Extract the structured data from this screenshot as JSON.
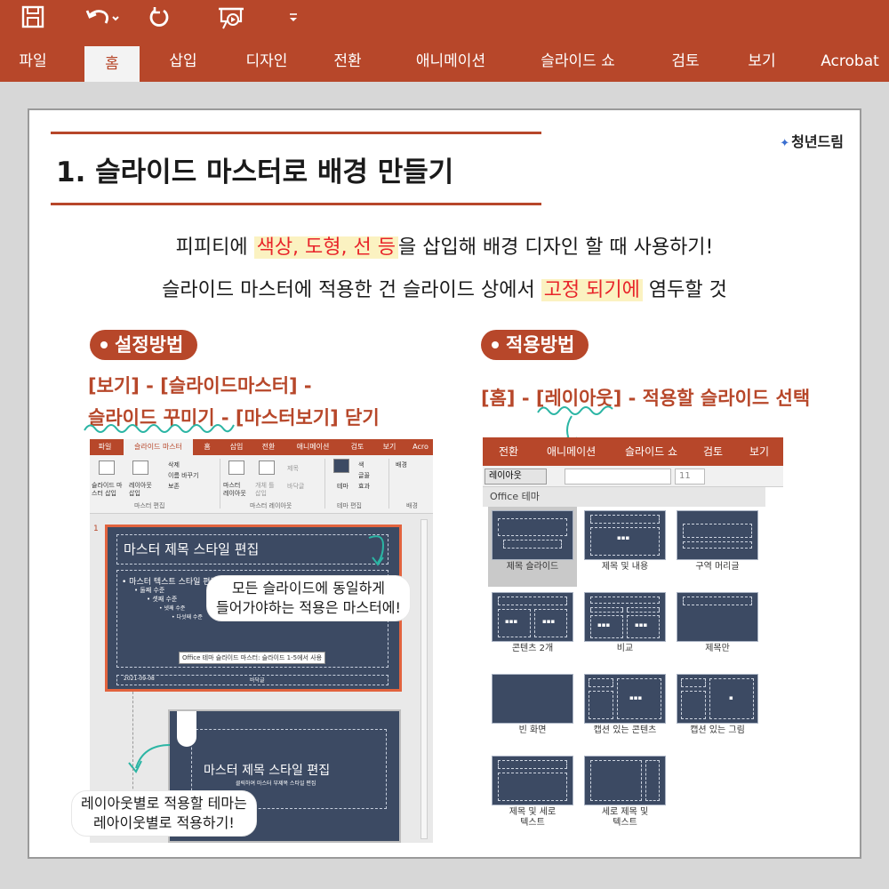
{
  "qat": {
    "save_icon": "save-icon",
    "undo_icon": "undo-icon",
    "redo_icon": "redo-icon",
    "present_icon": "present-from-start-icon",
    "customize_icon": "customize-qat-icon"
  },
  "ribbon_tabs": [
    {
      "label": "파일"
    },
    {
      "label": "홈",
      "active": true
    },
    {
      "label": "삽입"
    },
    {
      "label": "디자인"
    },
    {
      "label": "전환"
    },
    {
      "label": "애니메이션"
    },
    {
      "label": "슬라이드 쇼"
    },
    {
      "label": "검토"
    },
    {
      "label": "보기"
    },
    {
      "label": "Acrobat"
    }
  ],
  "card": {
    "title": "1. 슬라이드 마스터로 배경 만들기",
    "logo": "청년드림",
    "line1_pre": "피피티에 ",
    "line1_hl": "색상, 도형, 선 등",
    "line1_post": "을 삽입해  배경 디자인 할 때 사용하기!",
    "line2_pre": "슬라이드 마스터에 적용한 건 슬라이드 상에서 ",
    "line2_hl": "고정 되기에",
    "line2_post": " 염두할 것"
  },
  "setup": {
    "pill": "설정방법",
    "path_line1": "[보기] - [슬라이드마스터] -",
    "path_line2": "슬라이드 꾸미기 - [마스터보기] 닫기"
  },
  "apply": {
    "pill": "적용방법",
    "path": "[홈] - [레이아웃] - 적용할 슬라이드 선택"
  },
  "left_shot": {
    "tabs": [
      "파일",
      "슬라이드 마스터",
      "홈",
      "삽입",
      "전환",
      "애니메이션",
      "검토",
      "보기",
      "Acro"
    ],
    "ribbon": {
      "insert_master": "슬라이드 마\n스터 삽입",
      "insert_layout": "레이아웃\n삽입",
      "delete": "삭제",
      "rename": "이름 바꾸기",
      "preserve": "보존",
      "group1": "마스터 편집",
      "master_layout": "마스터\n레이아웃",
      "insert_placeholder": "개체 틀\n삽입",
      "title_check": "제목",
      "footer_check": "바닥글",
      "group2": "마스터 레이아웃",
      "theme": "테마",
      "colors": "색",
      "fonts": "글꼴",
      "effects": "효과",
      "group3": "테마 편집",
      "background": "배경",
      "group4": "배경"
    },
    "slide_number": "1",
    "master_title": "마스터 제목 스타일 편집",
    "master_text": "• 마스터 텍스트 스타일 편집",
    "level2": "• 둘째 수준",
    "level3": "• 셋째 수준",
    "level4": "• 넷째 수준",
    "level5": "• 다섯째 수준",
    "tooltip": "Office 테마 슬라이드 마스터: 슬라이드 1-5에서 사용",
    "footer_date": "2021-09-08",
    "footer_mid": "바닥글",
    "layout_title": "마스터 제목 스타일 편집",
    "layout_sub": "클릭하여 마스터 부제목 스타일 편집",
    "bubble1_line1": "모든 슬라이드에 동일하게",
    "bubble1_line2": "들어가야하는 적용은 마스터에!",
    "bubble2_line1": "레이아웃별로 적용할 테마는",
    "bubble2_line2": "레아이웃별로 적용하기!"
  },
  "right_shot": {
    "tabs": [
      "전환",
      "애니메이션",
      "슬라이드 쇼",
      "검토",
      "보기"
    ],
    "layout_button": "레이아웃",
    "font_size": "11",
    "theme_header": "Office 테마",
    "layouts": [
      {
        "name": "제목 슬라이드",
        "selected": true
      },
      {
        "name": "제목 및 내용"
      },
      {
        "name": "구역 머리글"
      },
      {
        "name": "콘텐츠 2개"
      },
      {
        "name": "비교"
      },
      {
        "name": "제목만"
      },
      {
        "name": "빈 화면"
      },
      {
        "name": "캡션 있는 콘텐츠"
      },
      {
        "name": "캡션 있는 그림"
      },
      {
        "name": "제목 및 세로\n텍스트"
      },
      {
        "name": "세로 제목 및\n텍스트"
      }
    ]
  },
  "colors": {
    "accent": "#b7472a",
    "highlight_bg": "#fbf2c1",
    "highlight_text": "#e8242a",
    "slide_bg": "#3c4a63",
    "teal_wave": "#2bb5a4"
  }
}
